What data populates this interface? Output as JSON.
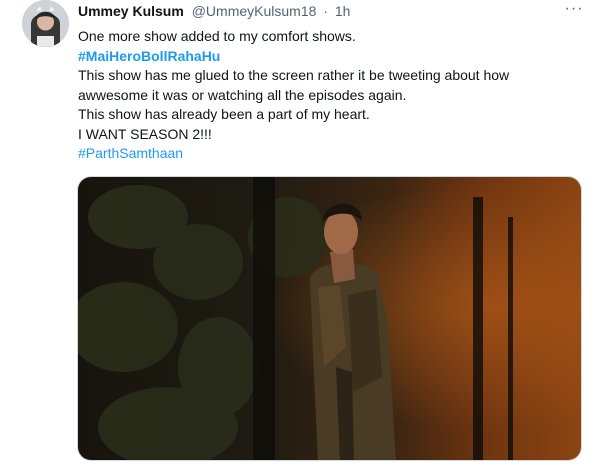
{
  "tweet": {
    "display_name": "Ummey Kulsum",
    "handle": "@UmmeyKulsum18",
    "separator": "·",
    "time": "1h",
    "more_label": "···",
    "lines": [
      "One more show added to my comfort shows.",
      "#MaiHeroBollRahaHu",
      "This show has me glued to the screen rather it be tweeting about how",
      "awwesome it was or watching all the episodes again.",
      "This show has already been a part of my heart.",
      "I WANT SEASON 2!!!",
      "#ParthSamthaan"
    ]
  },
  "colors": {
    "link": "#1d9bf0",
    "secondary_text": "#536471",
    "primary_text": "#0f1419"
  },
  "icons": {
    "more": "more-horizontal-icon"
  }
}
